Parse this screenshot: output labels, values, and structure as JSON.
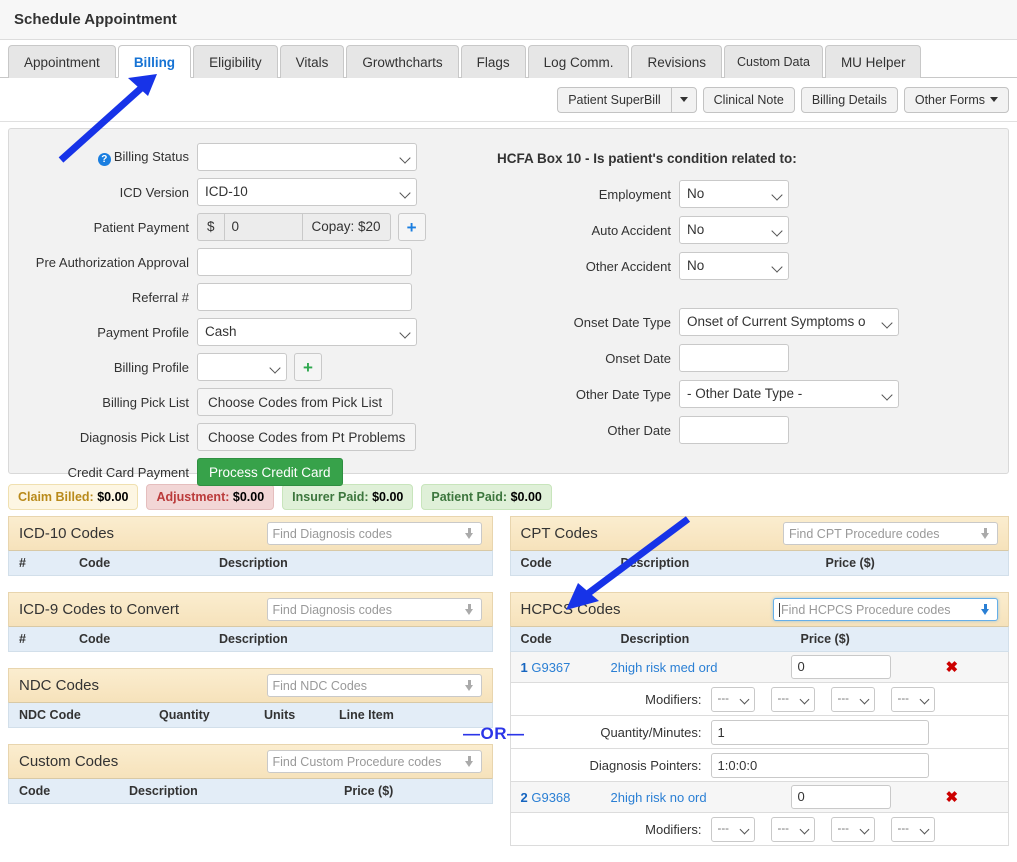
{
  "header": {
    "title": "Schedule Appointment"
  },
  "tabs": [
    {
      "label": "Appointment",
      "active": false
    },
    {
      "label": "Billing",
      "active": true
    },
    {
      "label": "Eligibility",
      "active": false
    },
    {
      "label": "Vitals",
      "active": false
    },
    {
      "label": "Growthcharts",
      "active": false
    },
    {
      "label": "Flags",
      "active": false
    },
    {
      "label": "Log Comm.",
      "active": false
    },
    {
      "label": "Revisions",
      "active": false
    },
    {
      "label": "Custom Data",
      "active": false
    },
    {
      "label": "MU Helper",
      "active": false
    }
  ],
  "toolbar": {
    "superbill_label": "Patient SuperBill",
    "superbill_caret_icon": "caret-down-icon",
    "clinical_note_label": "Clinical Note",
    "billing_details_label": "Billing Details",
    "other_forms_label": "Other Forms"
  },
  "form": {
    "billing_status": {
      "label": "Billing Status",
      "help_icon": "help-circle-icon",
      "value": ""
    },
    "icd_version": {
      "label": "ICD Version",
      "value": "ICD-10"
    },
    "patient_payment": {
      "label": "Patient Payment",
      "currency": "$",
      "value": "0",
      "copay": "Copay: $20",
      "add_icon": "plus-icon"
    },
    "pre_auth": {
      "label": "Pre Authorization Approval",
      "value": ""
    },
    "referral": {
      "label": "Referral #",
      "value": ""
    },
    "payment_profile": {
      "label": "Payment Profile",
      "value": "Cash"
    },
    "billing_profile": {
      "label": "Billing Profile",
      "value": "",
      "add_icon": "plus-icon"
    },
    "billing_pick_list": {
      "label": "Billing Pick List",
      "button": "Choose Codes from Pick List"
    },
    "diagnosis_pick_list": {
      "label": "Diagnosis Pick List",
      "button": "Choose Codes from Pt Problems"
    },
    "credit_card": {
      "label": "Credit Card Payment",
      "button": "Process Credit Card"
    }
  },
  "hcfa": {
    "title": "HCFA Box 10 - Is patient's condition related to:",
    "employment": {
      "label": "Employment",
      "value": "No"
    },
    "auto_accident": {
      "label": "Auto Accident",
      "value": "No"
    },
    "other_accident": {
      "label": "Other Accident",
      "value": "No"
    },
    "onset_date_type": {
      "label": "Onset Date Type",
      "value": "Onset of Current Symptoms o"
    },
    "onset_date": {
      "label": "Onset Date",
      "value": ""
    },
    "other_date_type": {
      "label": "Other Date Type",
      "value": "- Other Date Type -"
    },
    "other_date": {
      "label": "Other Date",
      "value": ""
    }
  },
  "badges": [
    {
      "label": "Claim Billed:",
      "amount": "$0.00"
    },
    {
      "label": "Adjustment:",
      "amount": "$0.00"
    },
    {
      "label": "Insurer Paid:",
      "amount": "$0.00"
    },
    {
      "label": "Patient Paid:",
      "amount": "$0.00"
    }
  ],
  "panels": {
    "icd10": {
      "title": "ICD-10 Codes",
      "search_placeholder": "Find Diagnosis codes",
      "columns": [
        "#",
        "Code",
        "Description"
      ],
      "rows": []
    },
    "icd9": {
      "title": "ICD-9 Codes to Convert",
      "search_placeholder": "Find Diagnosis codes",
      "columns": [
        "#",
        "Code",
        "Description"
      ],
      "rows": []
    },
    "ndc": {
      "title": "NDC Codes",
      "search_placeholder": "Find NDC Codes",
      "columns": [
        "NDC Code",
        "Quantity",
        "Units",
        "Line Item"
      ],
      "rows": []
    },
    "custom": {
      "title": "Custom Codes",
      "search_placeholder": "Find Custom Procedure codes",
      "columns": [
        "Code",
        "Description",
        "Price ($)"
      ],
      "rows": []
    },
    "cpt": {
      "title": "CPT Codes",
      "search_placeholder": "Find CPT Procedure codes",
      "columns": [
        "Code",
        "Description",
        "Price ($)"
      ],
      "rows": []
    },
    "hcpcs": {
      "title": "HCPCS Codes",
      "search_placeholder": "Find HCPCS Procedure codes",
      "search_focused": true,
      "columns": [
        "Code",
        "Description",
        "Price ($)"
      ],
      "rows": [
        {
          "num": "1",
          "code": "G9367",
          "description": "2high risk med ord",
          "price": "0",
          "delete_icon": "close-x-icon",
          "modifiers_label": "Modifiers:",
          "modifiers": [
            "---",
            "---",
            "---",
            "---"
          ],
          "quantity_label": "Quantity/Minutes:",
          "quantity": "1",
          "pointers_label": "Diagnosis Pointers:",
          "pointers": "1:0:0:0"
        },
        {
          "num": "2",
          "code": "G9368",
          "description": "2high risk no ord",
          "price": "0",
          "delete_icon": "close-x-icon",
          "modifiers_label": "Modifiers:",
          "modifiers": [
            "---",
            "---",
            "---",
            "---"
          ]
        }
      ]
    }
  },
  "divider": {
    "or_label": "—OR—"
  },
  "annotations": {
    "arrow_to_billing_tab": "blue-arrow-icon",
    "arrow_to_hcpcs_search": "blue-arrow-icon"
  },
  "colors": {
    "accent_blue": "#1673d4",
    "panel_header_tan": "#f8e6c2",
    "table_header_blue": "#e3edf7",
    "green_button": "#37a24a",
    "annotation_blue": "#2b35e8"
  }
}
